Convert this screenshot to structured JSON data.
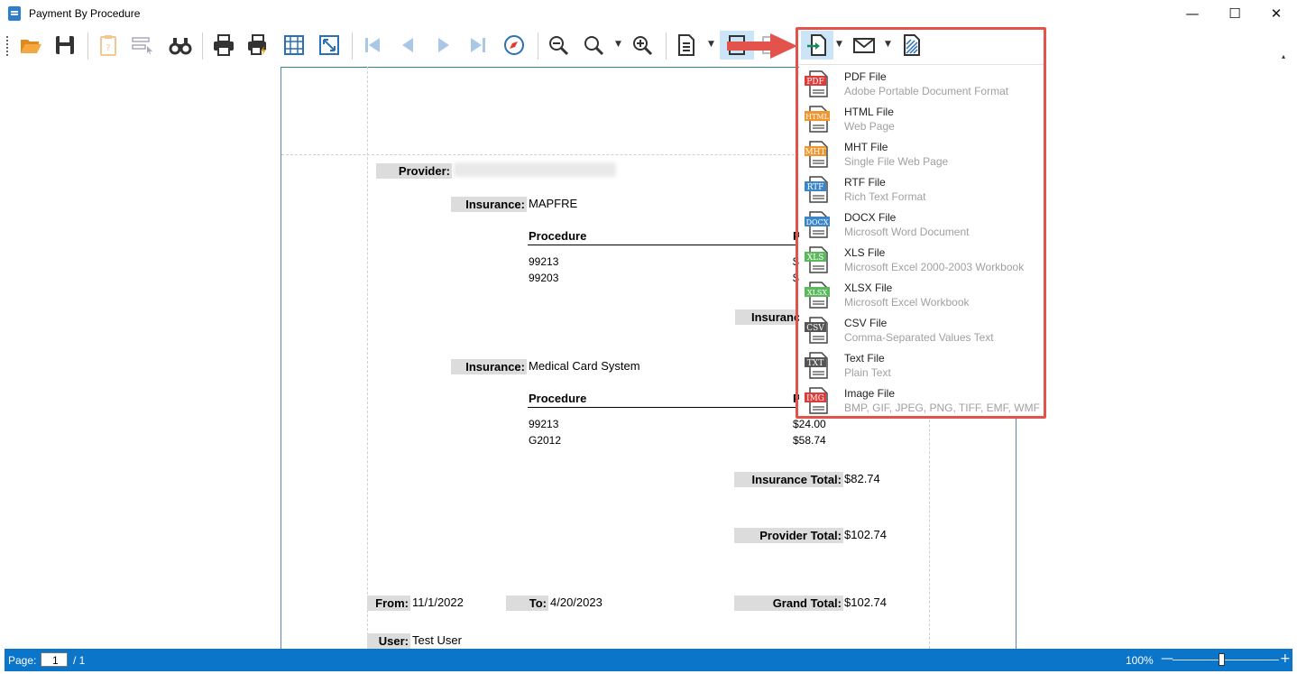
{
  "window": {
    "title": "Payment By Procedure",
    "minimize": "—",
    "maximize": "☐",
    "close": "✕"
  },
  "toolbar": {
    "items": [
      "open-icon",
      "save-icon",
      "parameters-icon",
      "editing-fields-icon",
      "find-icon",
      "print-icon",
      "quick-print-icon",
      "page-setup-icon",
      "scale-icon",
      "first-page-icon",
      "previous-page-icon",
      "next-page-icon",
      "last-page-icon",
      "navigation-icon",
      "zoom-out-icon",
      "zoom-icon",
      "zoom-in-icon",
      "page-layout-icon",
      "multiple-pages-icon",
      "export-icon",
      "send-email-icon",
      "watermark-icon"
    ],
    "overflow": "▴"
  },
  "report": {
    "provider_label": "Provider:",
    "groups": [
      {
        "insurance_label": "Insurance:",
        "insurance_name": "MAPFRE",
        "col_procedure": "Procedure",
        "col_payment": "P",
        "rows": [
          {
            "code": "99213",
            "amount": "$"
          },
          {
            "code": "99203",
            "amount": "$"
          }
        ],
        "total_label": "Insurance"
      },
      {
        "insurance_label": "Insurance:",
        "insurance_name": "Medical Card System",
        "col_procedure": "Procedure",
        "col_payment": "P",
        "rows": [
          {
            "code": "99213",
            "amount": "$24.00"
          },
          {
            "code": "G2012",
            "amount": "$58.74"
          }
        ],
        "total_label": "Insurance Total:",
        "total_value": "$82.74"
      }
    ],
    "provider_total_label": "Provider Total:",
    "provider_total_value": "$102.74",
    "from_label": "From:",
    "from_value": "11/1/2022",
    "to_label": "To:",
    "to_value": "4/20/2023",
    "grand_total_label": "Grand Total:",
    "grand_total_value": "$102.74",
    "user_label": "User:",
    "user_value": "Test User"
  },
  "export_menu": {
    "items": [
      {
        "badge": "PDF",
        "color": "#e03b3b",
        "title": "PDF File",
        "subtitle": "Adobe Portable Document Format"
      },
      {
        "badge": "HTML",
        "color": "#f0962e",
        "title": "HTML File",
        "subtitle": "Web Page"
      },
      {
        "badge": "MHT",
        "color": "#f0962e",
        "title": "MHT File",
        "subtitle": "Single File Web Page"
      },
      {
        "badge": "RTF",
        "color": "#3a86c8",
        "title": "RTF File",
        "subtitle": "Rich Text Format"
      },
      {
        "badge": "DOCX",
        "color": "#3a86c8",
        "title": "DOCX File",
        "subtitle": "Microsoft Word Document"
      },
      {
        "badge": "XLS",
        "color": "#5cb85c",
        "title": "XLS File",
        "subtitle": "Microsoft Excel 2000-2003 Workbook"
      },
      {
        "badge": "XLSX",
        "color": "#5cb85c",
        "title": "XLSX File",
        "subtitle": "Microsoft Excel Workbook"
      },
      {
        "badge": "CSV",
        "color": "#555555",
        "title": "CSV File",
        "subtitle": "Comma-Separated Values Text"
      },
      {
        "badge": "TXT",
        "color": "#555555",
        "title": "Text File",
        "subtitle": "Plain Text"
      },
      {
        "badge": "IMG",
        "color": "#e03b3b",
        "title": "Image File",
        "subtitle": "BMP, GIF, JPEG, PNG, TIFF, EMF, WMF"
      }
    ]
  },
  "statusbar": {
    "page_label": "Page:",
    "page_value": "1",
    "page_total": "/ 1",
    "zoom": "100%",
    "zoom_minus": "—",
    "zoom_plus": "+",
    "zoom_level": 0.46
  },
  "colors": {
    "accent": "#0a75c9",
    "highlight": "#e4524c"
  }
}
